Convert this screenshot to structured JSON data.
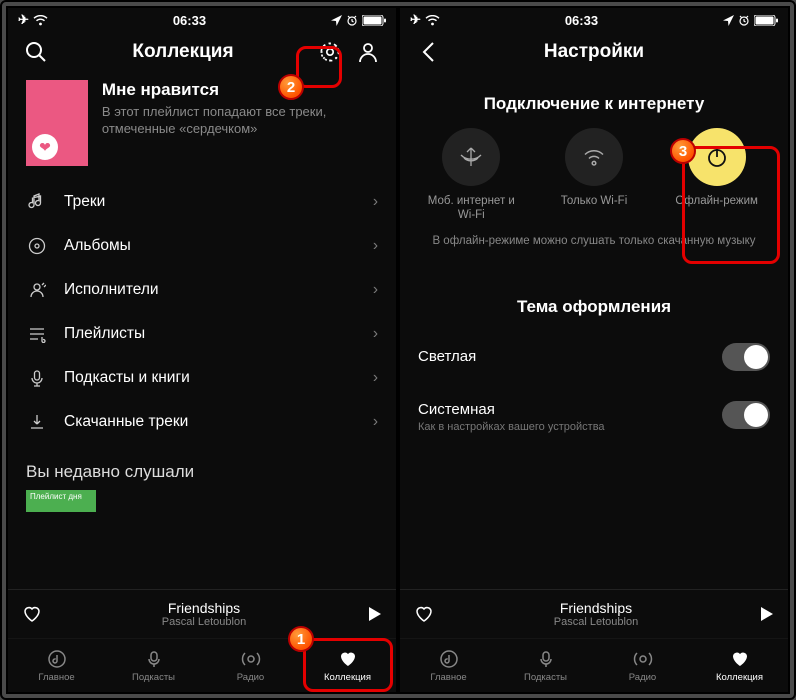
{
  "statusbar": {
    "time": "06:33"
  },
  "left": {
    "title": "Коллекция",
    "hero": {
      "title": "Мне нравится",
      "subtitle": "В этот плейлист попадают все треки, отмеченные «сердечком»"
    },
    "rows": {
      "tracks": "Треки",
      "albums": "Альбомы",
      "artists": "Исполнители",
      "playlists": "Плейлисты",
      "podcasts": "Подкасты и книги",
      "downloaded": "Скачанные треки"
    },
    "recent": "Вы недавно слушали",
    "recent_card": "Плейлист дня"
  },
  "right": {
    "title": "Настройки",
    "section_conn": "Подключение к интернету",
    "conn": {
      "mobwifi": "Моб. интернет и Wi-Fi",
      "wifi": "Только Wi-Fi",
      "offline": "Офлайн-режим"
    },
    "note": "В офлайн-режиме можно слушать только скачанную музыку",
    "section_theme": "Тема оформления",
    "theme": {
      "light": "Светлая",
      "system": "Системная",
      "system_sub": "Как в настройках вашего устройства"
    }
  },
  "player": {
    "track": "Friendships",
    "artist": "Pascal Letoublon"
  },
  "tabs": {
    "main": "Главное",
    "podcasts": "Подкасты",
    "radio": "Радио",
    "collection": "Коллекция"
  },
  "badges": {
    "b1": "1",
    "b2": "2",
    "b3": "3"
  }
}
